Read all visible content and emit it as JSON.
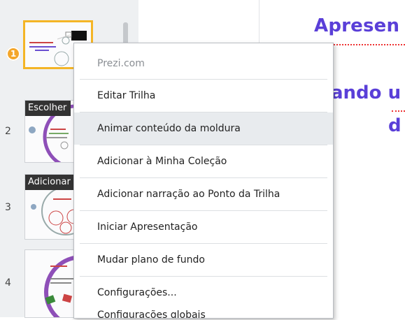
{
  "slides": [
    {
      "number": "1",
      "tag": ""
    },
    {
      "number": "2",
      "tag": "Escolher"
    },
    {
      "number": "3",
      "tag": "Adicionar"
    },
    {
      "number": "4",
      "tag": ""
    }
  ],
  "canvas": {
    "title_line1": "Apresen",
    "title_line2": "ando u",
    "title_line3": "d"
  },
  "menu": {
    "header": "Prezi.com",
    "items": [
      "Editar Trilha",
      "Animar conteúdo da moldura",
      "Adicionar à Minha Coleção",
      "Adicionar narração ao Ponto da Trilha",
      "Iniciar Apresentação",
      "Mudar plano de fundo",
      "Configurações...",
      "Configurações globais"
    ],
    "highlighted_index": 1
  },
  "colors": {
    "accent_title": "#5a3fd8",
    "active_border": "#f4b526",
    "highlight": "#e8ebee"
  }
}
